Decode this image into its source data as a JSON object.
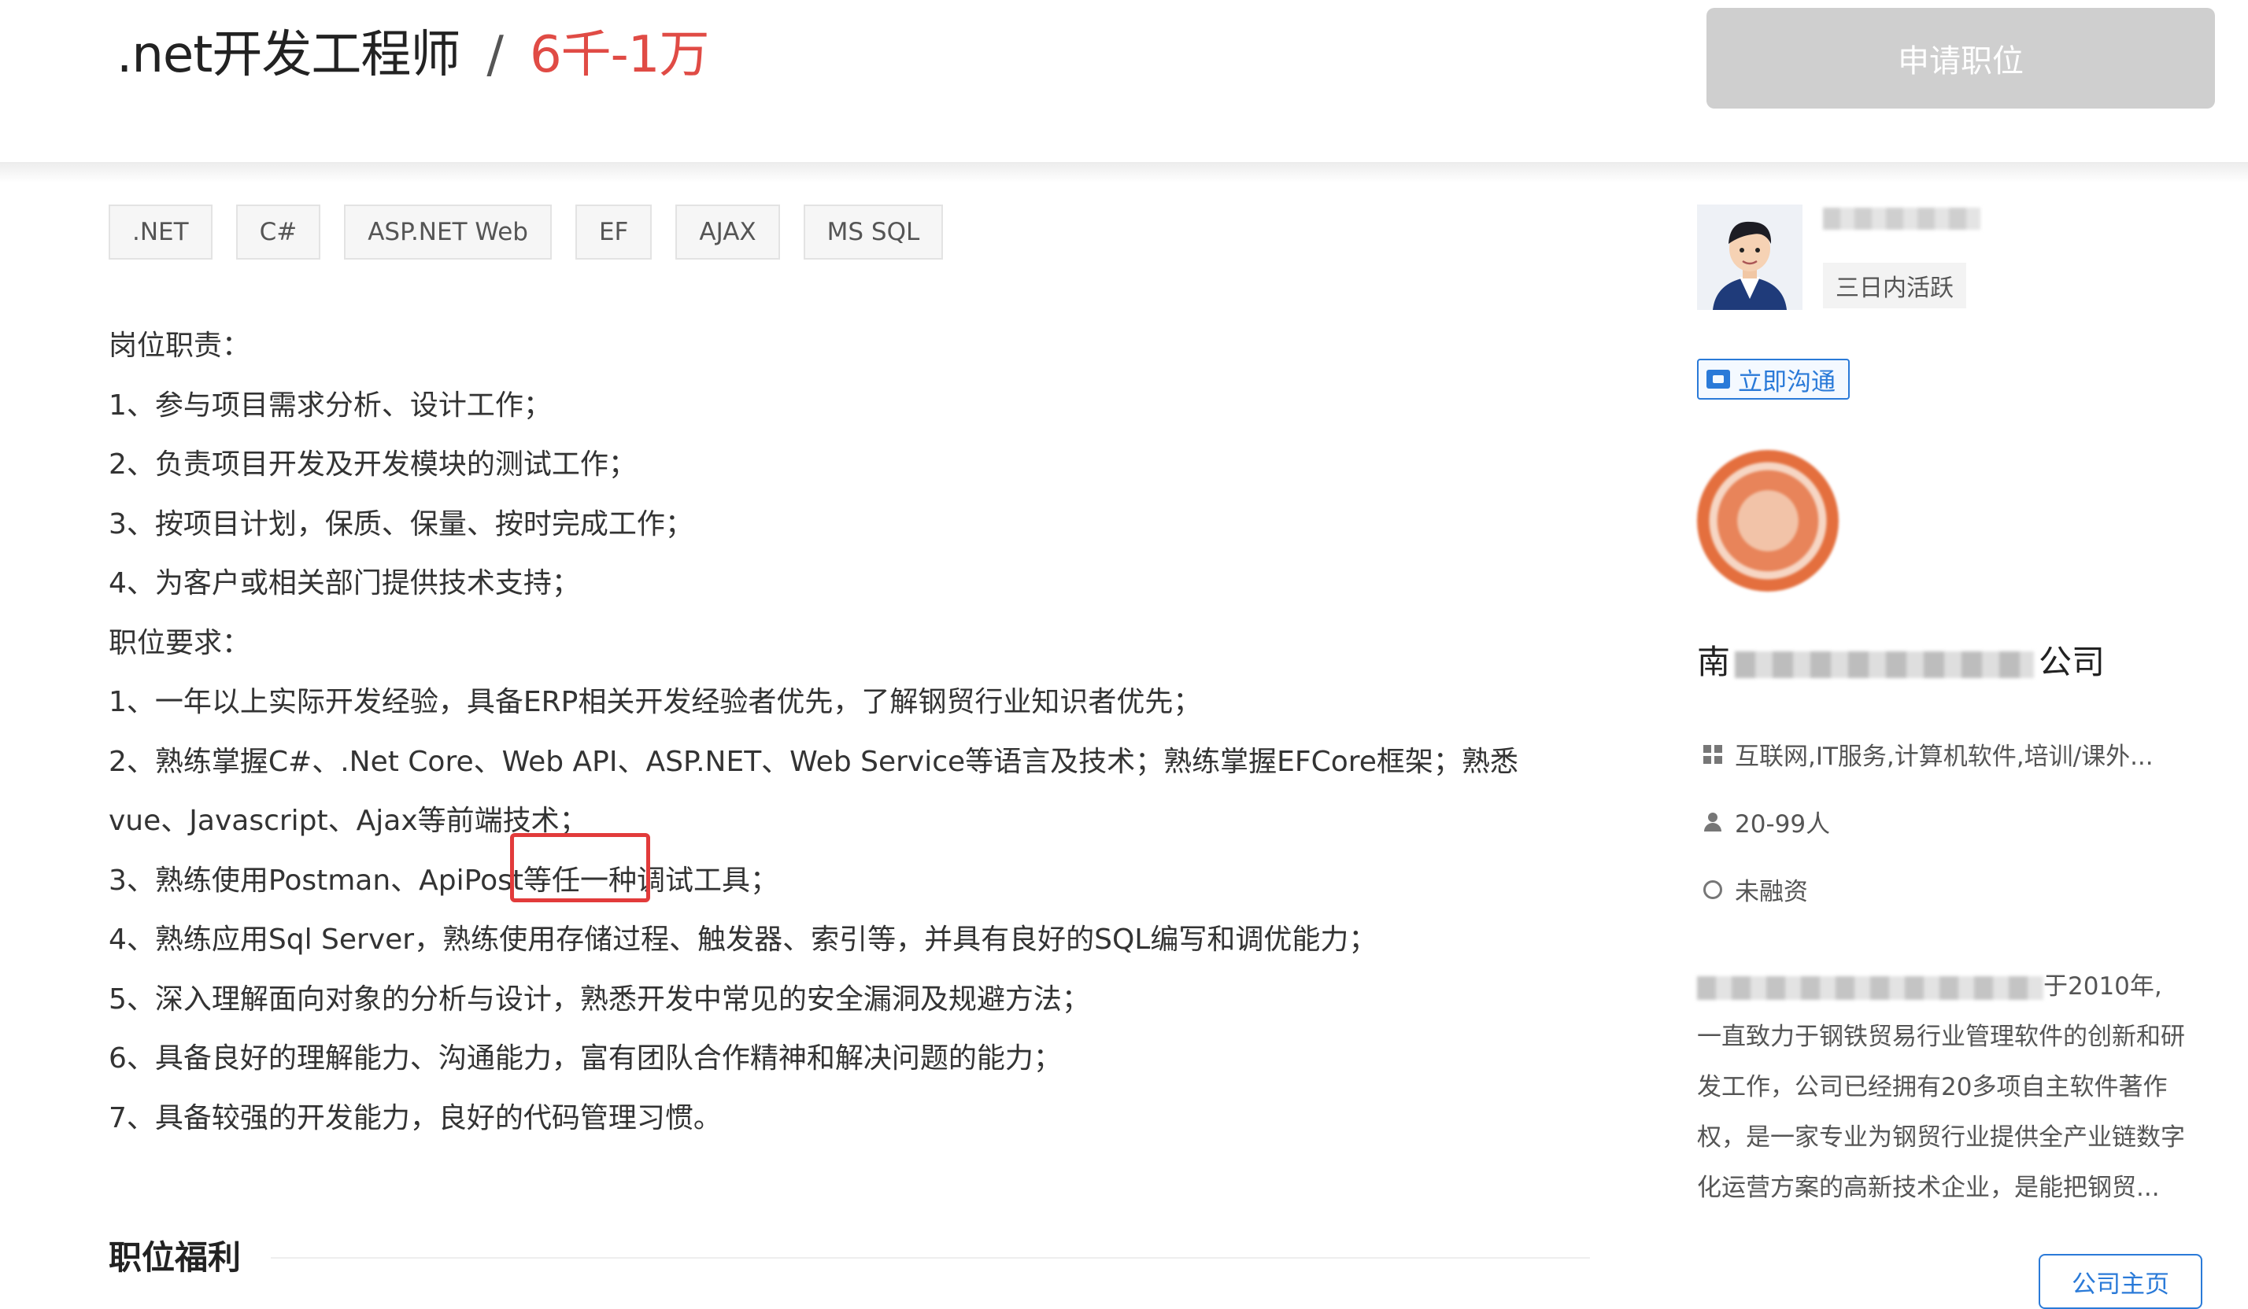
{
  "job": {
    "title": ".net开发工程师",
    "separator": "/",
    "salary": "6千-1万",
    "apply_label": "申请职位"
  },
  "tags": [
    ".NET",
    "C#",
    "ASP.NET Web",
    "EF",
    "AJAX",
    "MS SQL"
  ],
  "description": {
    "duties_heading": "岗位职责：",
    "duties": [
      "1、参与项目需求分析、设计工作；",
      "2、负责项目开发及开发模块的测试工作；",
      "3、按项目计划，保质、保量、按时完成工作；",
      "4、为客户或相关部门提供技术支持；"
    ],
    "requirements_heading": "职位要求：",
    "requirements": [
      "1、一年以上实际开发经验，具备ERP相关开发经验者优先，了解钢贸行业知识者优先；",
      "2、熟练掌握C#、.Net Core、Web API、ASP.NET、Web Service等语言及技术；熟练掌握EFCore框架；熟悉vue、Javascript、Ajax等前端技术；",
      "3、熟练使用Postman、ApiPost等任一种调试工具；",
      "4、熟练应用Sql Server，熟练使用存储过程、触发器、索引等，并具有良好的SQL编写和调优能力；",
      "5、深入理解面向对象的分析与设计，熟悉开发中常见的安全漏洞及规避方法；",
      "6、具备良好的理解能力、沟通能力，富有团队合作精神和解决问题的能力；",
      "7、具备较强的开发能力，良好的代码管理习惯。"
    ]
  },
  "benefits": {
    "title": "职位福利"
  },
  "recruiter": {
    "active_status": "三日内活跃",
    "chat_label": "立即沟通"
  },
  "company": {
    "name_prefix": "南",
    "name_suffix": "公司",
    "industry": "互联网,IT服务,计算机软件,培训/课外...",
    "size": "20-99人",
    "funding": "未融资",
    "desc_line1_suffix": "于2010年,",
    "desc_rest": "一直致力于钢铁贸易行业管理软件的创新和研发工作，公司已经拥有20多项自主软件著作权，是一家专业为钢贸行业提供全产业链数字化运营方案的高新技术企业，是能把钢贸...",
    "home_label": "公司主页"
  }
}
